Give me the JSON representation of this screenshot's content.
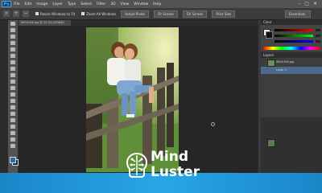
{
  "menubar": {
    "app_badge": "Ps",
    "items": [
      "File",
      "Edit",
      "Image",
      "Layer",
      "Type",
      "Select",
      "Filter",
      "3D",
      "View",
      "Window",
      "Help"
    ],
    "window_controls": [
      "–",
      "▢",
      "✕"
    ]
  },
  "options": {
    "check1_label": "Resize Windows to Fit",
    "check2_label": "Zoom All Windows",
    "buttons": [
      "Actual Pixels",
      "Fit Screen",
      "Fill Screen",
      "Print Size"
    ],
    "workspace": "Essentials"
  },
  "document": {
    "tab_label": "IMG0156.jpg @ 33.3% (RGB/8)"
  },
  "panels": {
    "color_title": "Color",
    "layers_title": "Layers",
    "layer_rows": [
      "IMG0156.jpg",
      "Layer 1"
    ]
  },
  "brand": {
    "line1": "Mind",
    "line2": "Luster"
  },
  "colors": {
    "accent": "#28a6e6",
    "ui_dark": "#2b2b2b",
    "selection": "#4c6a8b"
  }
}
